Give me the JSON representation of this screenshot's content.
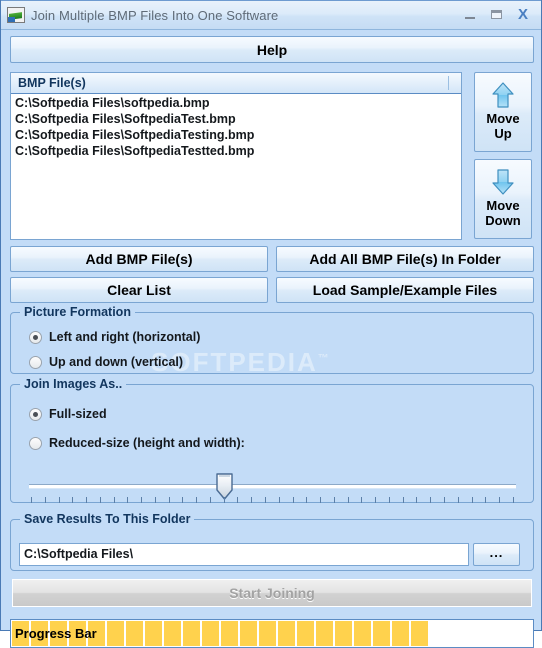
{
  "window": {
    "title": "Join Multiple BMP Files Into One Software",
    "icon": "app-image-icon",
    "controls": {
      "minimize": "–",
      "maximize": "□",
      "close": "X"
    }
  },
  "toolbar": {
    "help_label": "Help"
  },
  "file_list": {
    "header": "BMP File(s)",
    "items": [
      "C:\\Softpedia Files\\softpedia.bmp",
      "C:\\Softpedia Files\\SoftpediaTest.bmp",
      "C:\\Softpedia Files\\SoftpediaTesting.bmp",
      "C:\\Softpedia Files\\SoftpediaTestted.bmp"
    ]
  },
  "order_buttons": {
    "move_up": {
      "line1": "Move",
      "line2": "Up",
      "icon": "arrow-up-icon"
    },
    "move_down": {
      "line1": "Move",
      "line2": "Down",
      "icon": "arrow-down-icon"
    }
  },
  "actions": {
    "add_files": "Add BMP File(s)",
    "add_folder": "Add All BMP File(s) In Folder",
    "clear_list": "Clear List",
    "load_samples": "Load Sample/Example Files"
  },
  "picture_formation": {
    "title": "Picture Formation",
    "options": [
      {
        "label": "Left and right (horizontal)",
        "checked": true
      },
      {
        "label": "Up and down (vertical)",
        "checked": false
      }
    ]
  },
  "join_images_as": {
    "title": "Join Images As..",
    "options": [
      {
        "label": "Full-sized",
        "checked": true
      },
      {
        "label": "Reduced-size (height and width):",
        "checked": false
      }
    ],
    "slider": {
      "position_percent": 39,
      "tick_count": 36
    }
  },
  "save_folder": {
    "title": "Save Results To This Folder",
    "path_value": "C:\\Softpedia Files\\",
    "browse_label": "..."
  },
  "start": {
    "label": "Start Joining",
    "enabled": false
  },
  "progress": {
    "label": "Progress Bar",
    "percent": 76,
    "segments": 22,
    "color": "#ffd24d"
  },
  "watermark": {
    "text": "SOFTPEDIA",
    "tm": "™"
  },
  "colors": {
    "window_bg": "#c3dcf7",
    "border": "#7aa5d2",
    "group_label": "#12365e",
    "progress_fill": "#ffd24d",
    "disabled_text": "#a3a3a3"
  }
}
